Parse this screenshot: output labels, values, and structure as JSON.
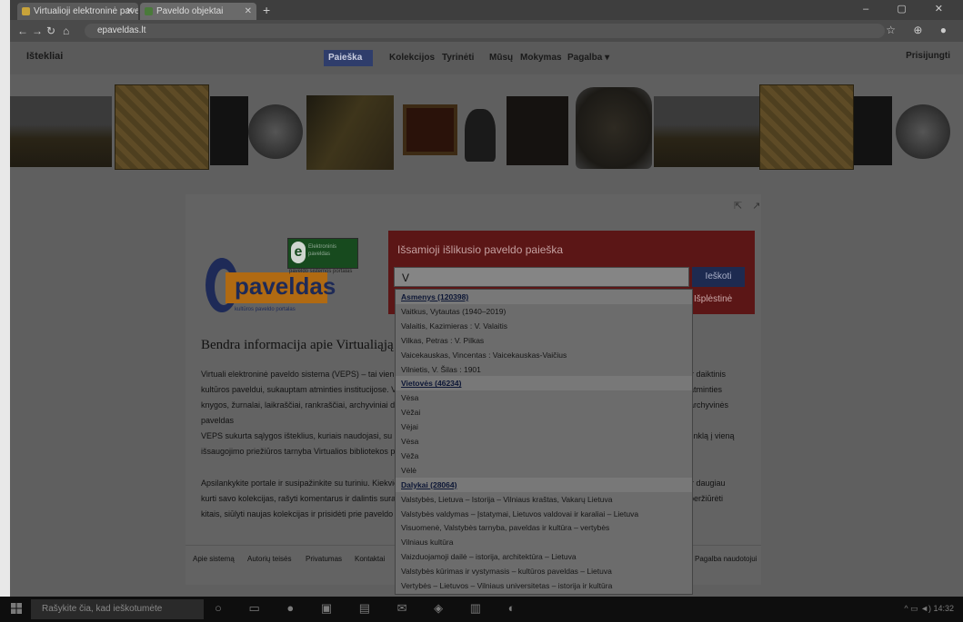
{
  "browser": {
    "tabs": [
      {
        "label": "Virtualioji elektroninė paveldo sistema",
        "fav_color": "#c8a33a",
        "active": false
      },
      {
        "label": "Paveldo objektai",
        "fav_color": "#4a7a3a",
        "active": true
      }
    ],
    "new_tab": "+",
    "window_controls": "– ▢ ✕",
    "nav": {
      "back": "←",
      "forward": "→",
      "reload": "↻",
      "home": "⌂"
    },
    "url": "epaveldas.lt",
    "addr_icons": "☆ ⊕ ●"
  },
  "site_nav": {
    "brand": "Ištekliai",
    "items": [
      "Paieška",
      "Kolekcijos",
      "Tyrinėti",
      "Mūsų",
      "Mokymas",
      "Pagalba ▾"
    ],
    "login": "Prisijungti"
  },
  "main": {
    "top_icons": "⇱ ↗",
    "logo_text": "paveldas",
    "logo_e": "e",
    "logo_sub": "kultūros paveldo portalas",
    "badge_letter": "e",
    "badge_text": "Elektroninis paveldas",
    "badge_caption": "paveldo sistemos portalas",
    "search": {
      "title": "Išsamioji išlikusio paveldo paieška",
      "value": "V",
      "button": "Ieškoti",
      "link": "Išplėstinė"
    },
    "heading": "Bendra informacija apie Virtualiąją elektroninę paveldo sistemą",
    "para1": [
      "Virtuali elektroninė paveldo sistema (VEPS) – tai vieningas informacinis išteklius",
      "kultūros paveldui, sukauptam atminties institucijose. VEPS portale skelbiami",
      "knygos, žurnalai, laikraščiai, rankraščiai, archyviniai dokumentai, muzikos",
      "paveldas",
      "VEPS sukurta sąlygos išteklius, kuriais naudojasi, su kultūros paveldo",
      "išsaugojimo priežiūros tarnyba Virtualios bibliotekos portale"
    ],
    "para1_right": [
      "ir daiktinis",
      "atminties",
      "archyvinės",
      "",
      "tinklą į vieną"
    ],
    "para2": [
      "Apsilankykite portale ir susipažinkite su turiniu. Kiekvienas naudotojas gali",
      "kurti savo kolekcijas, rašyti komentarus ir dalintis surasta informacija su",
      "kitais, siūlyti naujas kolekcijas ir prisidėti prie paveldo skaitmeninimo"
    ],
    "para2_right": [
      "ir daugiau",
      "peržiūrėti",
      ""
    ],
    "footer_links": [
      "Apie sistemą",
      "Autorių teisės",
      "Privatumas",
      "Kontaktai",
      "Pagalba naudotojui"
    ]
  },
  "dropdown": {
    "rows": [
      {
        "type": "cat",
        "text": "Asmenys (120398)"
      },
      {
        "type": "item",
        "text": "Vaitkus, Vytautas (1940–2019)"
      },
      {
        "type": "item",
        "text": "Valaitis, Kazimieras : V. Valaitis"
      },
      {
        "type": "item",
        "text": "Vilkas, Petras : V. Pilkas"
      },
      {
        "type": "item",
        "text": "Vaicekauskas, Vincentas : Vaicekauskas-Vaičius"
      },
      {
        "type": "item",
        "text": "Vilnietis, V. Šilas : 1901"
      },
      {
        "type": "cat",
        "text": "Vietovės (46234)"
      },
      {
        "type": "item",
        "text": "Vėsa"
      },
      {
        "type": "item",
        "text": "Vėžai"
      },
      {
        "type": "item",
        "text": "Vėjai"
      },
      {
        "type": "item",
        "text": "Vėsa"
      },
      {
        "type": "item",
        "text": "Vėža"
      },
      {
        "type": "item",
        "text": "Vėlė"
      },
      {
        "type": "cat",
        "text": "Dalykai (28064)"
      },
      {
        "type": "item",
        "text": "Valstybės, Lietuva – Istorija – Vilniaus kraštas, Vakarų Lietuva"
      },
      {
        "type": "item",
        "text": "Valstybės valdymas – Įstatymai, Lietuvos valdovai ir karaliai – Lietuva"
      },
      {
        "type": "item",
        "text": "Visuomenė, Valstybės tarnyba, paveldas ir kultūra – vertybės"
      },
      {
        "type": "item",
        "text": "Vilniaus kultūra"
      },
      {
        "type": "item",
        "text": "Vaizduojamoji dailė – istorija, architektūra – Lietuva"
      },
      {
        "type": "item",
        "text": "Valstybės kūrimas ir vystymasis – kultūros paveldas – Lietuva"
      },
      {
        "type": "item",
        "text": "Vertybės – Lietuvos – Vilniaus universitetas – istorija ir kultūra"
      }
    ]
  },
  "taskbar": {
    "start": "⊞",
    "search_placeholder": "Rašykite čia, kad ieškotumėte",
    "icons": "○ ▭ ● ▣ ▤ ✉ ◈ ▥ ◐",
    "tray": "^ ▭ ◄) 14:32"
  },
  "colors": {
    "nav_active": "#2f3d6b",
    "search_box": "#5b1616",
    "badge": "#174a1e",
    "logo_orange": "#b06a12",
    "logo_blue": "#1e2a57"
  }
}
